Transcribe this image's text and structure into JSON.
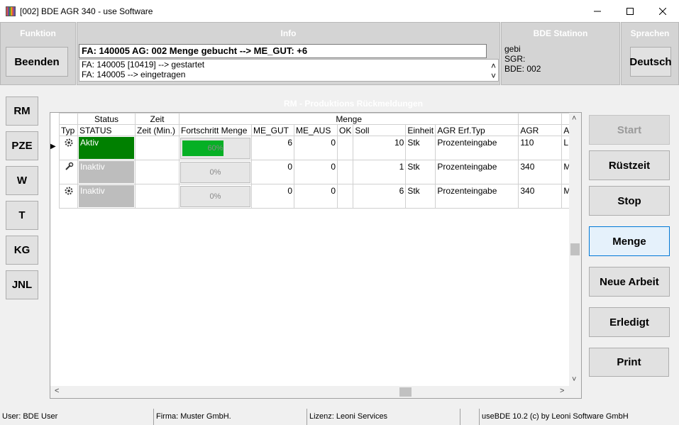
{
  "window": {
    "title": "[002] BDE AGR 340 - use Software"
  },
  "panels": {
    "funktion": {
      "title": "Funktion",
      "button": "Beenden"
    },
    "info": {
      "title": "Info",
      "headline": "FA: 140005 AG: 002 Menge gebucht --> ME_GUT: +6",
      "lines": [
        "FA: 140005 [10419] --> gestartet",
        "FA: 140005 --> eingetragen"
      ]
    },
    "station": {
      "title": "BDE Statinon",
      "lines": [
        "gebi",
        "SGR:",
        "BDE: 002"
      ]
    },
    "sprachen": {
      "title": "Sprachen",
      "button": "Deutsch"
    }
  },
  "sidebar": [
    "RM",
    "PZE",
    "W",
    "T",
    "KG",
    "JNL"
  ],
  "section_title": "RM - Produktions Rückmeldungen",
  "grid": {
    "group_headers": {
      "status": "Status",
      "zeit": "Zeit",
      "menge": "Menge"
    },
    "columns": [
      "Typ",
      "STATUS",
      "Zeit (Min.)",
      "Fortschritt Menge",
      "ME_GUT",
      "ME_AUS",
      "OK",
      "Soll",
      "Einheit",
      "AGR Erf.Typ",
      "AGR",
      "A"
    ],
    "rows": [
      {
        "typ_icon": "gear-icon",
        "status": "Aktiv",
        "zeit": "",
        "progress": 60,
        "progress_label": "60%",
        "me_gut": "6",
        "me_aus": "0",
        "ok": "",
        "soll": "10",
        "einheit": "Stk",
        "erf_typ": "Prozenteingabe",
        "agr": "110",
        "a": "L"
      },
      {
        "typ_icon": "wrench-icon",
        "status": "Inaktiv",
        "zeit": "",
        "progress": 0,
        "progress_label": "0%",
        "me_gut": "0",
        "me_aus": "0",
        "ok": "",
        "soll": "1",
        "einheit": "Stk",
        "erf_typ": "Prozenteingabe",
        "agr": "340",
        "a": "M"
      },
      {
        "typ_icon": "gear-icon",
        "status": "Inaktiv",
        "zeit": "",
        "progress": 0,
        "progress_label": "0%",
        "me_gut": "0",
        "me_aus": "0",
        "ok": "",
        "soll": "6",
        "einheit": "Stk",
        "erf_typ": "Prozenteingabe",
        "agr": "340",
        "a": "M"
      }
    ]
  },
  "actions": {
    "start": "Start",
    "ruestzeit": "Rüstzeit",
    "stop": "Stop",
    "menge": "Menge",
    "neue_arbeit": "Neue Arbeit",
    "erledigt": "Erledigt",
    "print": "Print"
  },
  "statusbar": {
    "user": "User: BDE User",
    "firma": "Firma: Muster GmbH.",
    "lizenz": "Lizenz: Leoni Services",
    "empty": "",
    "version": "useBDE 10.2 (c) by Leoni Software GmbH"
  },
  "colors": {
    "active_status": "#008000",
    "inactive_status": "#bdbdbd",
    "progress": "#06b025"
  }
}
